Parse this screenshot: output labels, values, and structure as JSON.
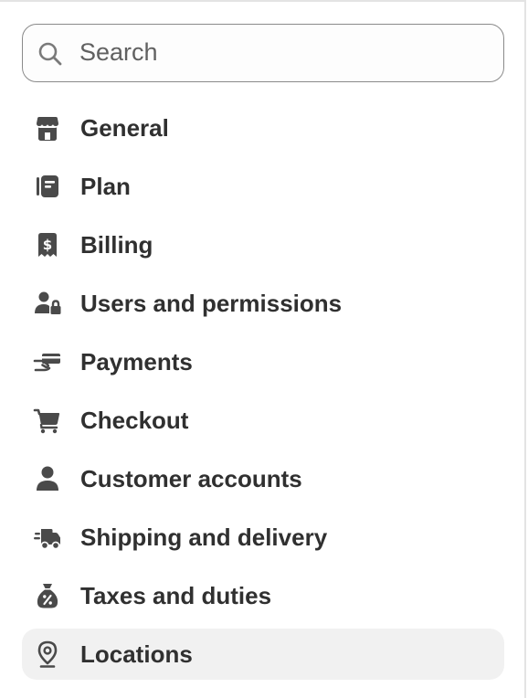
{
  "search": {
    "placeholder": "Search",
    "icon": "search-icon"
  },
  "nav": {
    "items": [
      {
        "label": "General",
        "icon": "store-icon"
      },
      {
        "label": "Plan",
        "icon": "plan-icon"
      },
      {
        "label": "Billing",
        "icon": "receipt-dollar-icon"
      },
      {
        "label": "Users and permissions",
        "icon": "user-lock-icon"
      },
      {
        "label": "Payments",
        "icon": "hand-card-icon"
      },
      {
        "label": "Checkout",
        "icon": "cart-icon"
      },
      {
        "label": "Customer accounts",
        "icon": "person-icon"
      },
      {
        "label": "Shipping and delivery",
        "icon": "truck-icon"
      },
      {
        "label": "Taxes and duties",
        "icon": "tax-bag-icon"
      },
      {
        "label": "Locations",
        "icon": "location-pin-icon",
        "selected": true
      }
    ]
  },
  "colors": {
    "text": "#303030",
    "icon": "#4a4a4a",
    "selected_bg": "#f1f1f1",
    "border": "#8a8a8a"
  }
}
